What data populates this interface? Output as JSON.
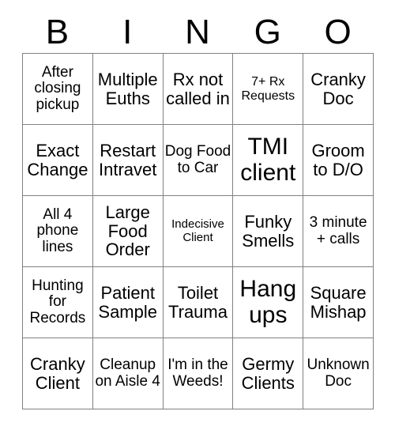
{
  "card": {
    "header_letters": [
      "B",
      "I",
      "N",
      "G",
      "O"
    ],
    "columns": 5,
    "rows": 5,
    "border_color": "#808080",
    "text_color": "#000000",
    "background_color": "#ffffff",
    "cells": [
      [
        {
          "text": "After closing pickup",
          "size": "md"
        },
        {
          "text": "Multiple Euths",
          "size": "lg"
        },
        {
          "text": "Rx not called in",
          "size": "lg"
        },
        {
          "text": "7+ Rx Requests",
          "size": "sm"
        },
        {
          "text": "Cranky Doc",
          "size": "lg"
        }
      ],
      [
        {
          "text": "Exact Change",
          "size": "lg"
        },
        {
          "text": "Restart Intravet",
          "size": "lg"
        },
        {
          "text": "Dog Food to Car",
          "size": "md"
        },
        {
          "text": "TMI client",
          "size": "xl"
        },
        {
          "text": "Groom to D/O",
          "size": "lg"
        }
      ],
      [
        {
          "text": "All 4 phone lines",
          "size": "md"
        },
        {
          "text": "Large Food Order",
          "size": "lg"
        },
        {
          "text": "Indecisive Client",
          "size": "xs"
        },
        {
          "text": "Funky Smells",
          "size": "lg"
        },
        {
          "text": "3 minute + calls",
          "size": "md"
        }
      ],
      [
        {
          "text": "Hunting for Records",
          "size": "md"
        },
        {
          "text": "Patient Sample",
          "size": "lg"
        },
        {
          "text": "Toilet Trauma",
          "size": "lg"
        },
        {
          "text": "Hang ups",
          "size": "xl"
        },
        {
          "text": "Square Mishap",
          "size": "lg"
        }
      ],
      [
        {
          "text": "Cranky Client",
          "size": "lg"
        },
        {
          "text": "Cleanup on Aisle 4",
          "size": "md"
        },
        {
          "text": "I'm in the Weeds!",
          "size": "md"
        },
        {
          "text": "Germy Clients",
          "size": "lg"
        },
        {
          "text": "Unknown Doc",
          "size": "md"
        }
      ]
    ]
  }
}
